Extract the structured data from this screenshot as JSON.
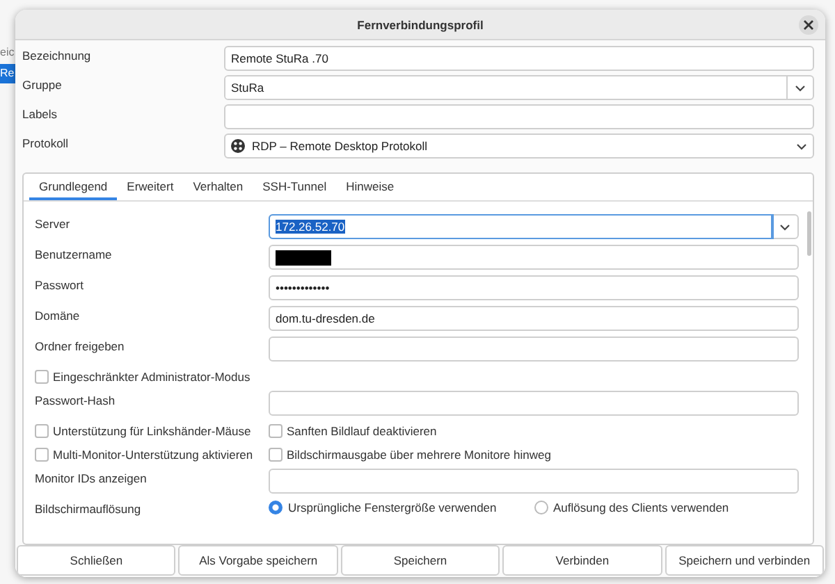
{
  "background_app": {
    "header_fragment": "eic",
    "selected_row_fragment": "Re"
  },
  "dialog": {
    "title": "Fernverbindungsprofil"
  },
  "profile_fields": [
    {
      "label": "Bezeichnung",
      "kind": "text",
      "value": "Remote StuRa .70"
    },
    {
      "label": "Gruppe",
      "kind": "combo",
      "value": "StuRa"
    },
    {
      "label": "Labels",
      "kind": "text"
    },
    {
      "label": "Protokoll",
      "kind": "dropdown",
      "value": "RDP – Remote Desktop Protokoll"
    }
  ],
  "tabs": [
    {
      "label": "Grundlegend",
      "selected": true
    },
    {
      "label": "Erweitert",
      "selected": false
    },
    {
      "label": "Verhalten",
      "selected": false
    },
    {
      "label": "SSH-Tunnel",
      "selected": false
    },
    {
      "label": "Hinweise",
      "selected": false
    }
  ],
  "settings": [
    {
      "kind": "combo",
      "label": "Server",
      "value": "172.26.52.70",
      "focused": true
    },
    {
      "kind": "redacted",
      "label": "Benutzername"
    },
    {
      "kind": "text",
      "label": "Passwort",
      "value": "•••••••••••••"
    },
    {
      "kind": "text",
      "label": "Domäne",
      "value": "dom.tu-dresden.de"
    },
    {
      "kind": "text",
      "label": "Ordner freigeben"
    },
    {
      "kind": "checks",
      "items": [
        {
          "label": "Eingeschränkter Administrator-Modus",
          "checked": false
        }
      ]
    },
    {
      "kind": "text",
      "label": "Passwort-Hash"
    },
    {
      "kind": "checks",
      "items": [
        {
          "label": "Unterstützung für Linkshänder-Mäuse",
          "checked": false
        },
        {
          "label": "Sanften Bildlauf deaktivieren",
          "checked": false
        }
      ]
    },
    {
      "kind": "checks",
      "items": [
        {
          "label": "Multi-Monitor-Unterstützung aktivieren",
          "checked": false
        },
        {
          "label": "Bildschirmausgabe über mehrere Monitore hinweg",
          "checked": false
        }
      ]
    },
    {
      "kind": "text",
      "label": "Monitor IDs anzeigen"
    },
    {
      "kind": "radios",
      "label": "Bildschirmauflösung",
      "options": [
        {
          "label": "Ursprüngliche Fenstergröße verwenden",
          "selected": true
        },
        {
          "label": "Auflösung des Clients verwenden",
          "selected": false
        }
      ]
    }
  ],
  "buttons": [
    "Schließen",
    "Als Vorgabe speichern",
    "Speichern",
    "Verbinden",
    "Speichern und verbinden"
  ]
}
